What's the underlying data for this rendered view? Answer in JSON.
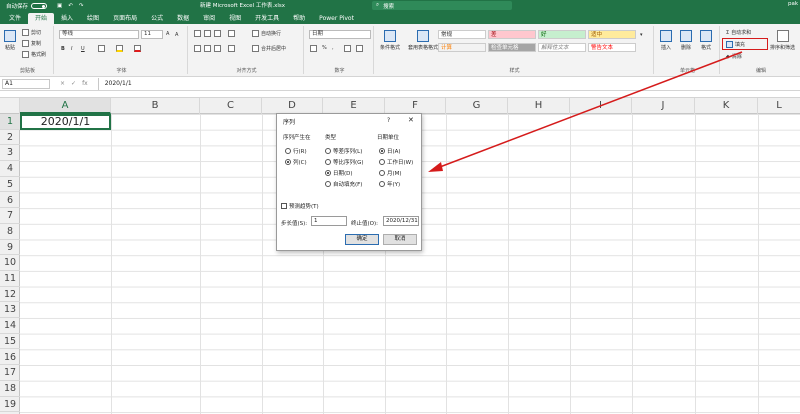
{
  "titlebar": {
    "autosave": "自动保存",
    "autosave_state": "关",
    "title": "新建 Microsoft Excel 工作表.xlsx",
    "search": "搜索",
    "user": "pak"
  },
  "tabs": [
    "文件",
    "开始",
    "插入",
    "绘图",
    "页面布局",
    "公式",
    "数据",
    "审阅",
    "视图",
    "开发工具",
    "帮助",
    "Power Pivot"
  ],
  "active_tab": "开始",
  "ribbon": {
    "clipboard": {
      "paste": "粘贴",
      "cut": "剪切",
      "copy": "复制",
      "painter": "格式刷",
      "label": "剪贴板"
    },
    "font": {
      "name": "等线",
      "size": "11",
      "bold": "B",
      "italic": "I",
      "underline": "U",
      "grow": "A",
      "shrink": "A",
      "label": "字体"
    },
    "alignment": {
      "wrap": "自动换行",
      "merge": "合并后居中",
      "label": "对齐方式"
    },
    "number": {
      "format": "日期",
      "percent": "%",
      "comma": ",",
      "label": "数字"
    },
    "styles": {
      "conditional": "条件格式",
      "table": "套用表格格式",
      "normal": "常规",
      "bad": "差",
      "good": "好",
      "neutral": "适中",
      "calc": "计算",
      "check": "检查单元格",
      "explanatory": "解释性文本",
      "warning": "警告文本",
      "label": "样式"
    },
    "cells": {
      "insert": "插入",
      "delete": "删除",
      "format": "格式",
      "label": "单元格"
    },
    "editing": {
      "autosum": "自动求和",
      "fill": "填充",
      "clear": "清除",
      "sort": "排序和筛选",
      "label": "编辑"
    }
  },
  "formula_bar": {
    "name_box": "A1",
    "cancel": "×",
    "enter": "✓",
    "fx": "fx",
    "content": "2020/1/1"
  },
  "columns": [
    "A",
    "B",
    "C",
    "D",
    "E",
    "F",
    "G",
    "H",
    "I",
    "J",
    "K",
    "L"
  ],
  "selected_column": "A",
  "rows": [
    "1",
    "2",
    "3",
    "4",
    "5",
    "6",
    "7",
    "8",
    "9",
    "10",
    "11",
    "12",
    "13",
    "14",
    "15",
    "16",
    "17",
    "18",
    "19"
  ],
  "cell_a1": "2020/1/1",
  "dialog": {
    "title": "序列",
    "help": "?",
    "close": "✕",
    "series_in": {
      "label": "序列产生在",
      "options": [
        "行(R)",
        "列(C)"
      ],
      "selected": 1
    },
    "type": {
      "label": "类型",
      "options": [
        "等差序列(L)",
        "等比序列(G)",
        "日期(D)",
        "自动填充(F)"
      ],
      "selected": 2
    },
    "date_unit": {
      "label": "日期单位",
      "options": [
        "日(A)",
        "工作日(W)",
        "月(M)",
        "年(Y)"
      ],
      "selected": 0
    },
    "trend": "预测趋势(T)",
    "step_label": "步长值(S):",
    "step_value": "1",
    "stop_label": "终止值(O):",
    "stop_value": "2020/12/31",
    "ok": "确定",
    "cancel": "取消"
  },
  "colors": {
    "excel_green": "#217346",
    "annotation_red": "#d51b1b"
  }
}
